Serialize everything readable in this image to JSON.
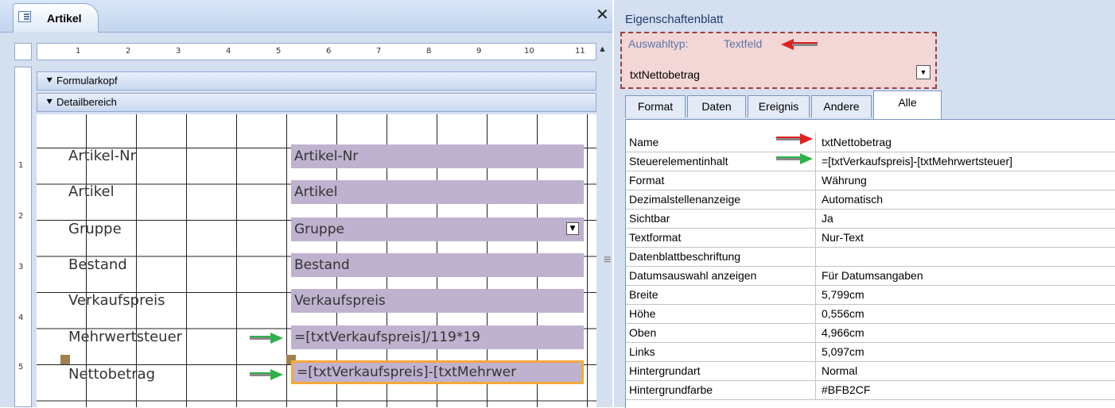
{
  "left_panel": {
    "tab_title": "Artikel",
    "close_label": "✕",
    "ruler_h": [
      "1",
      "2",
      "3",
      "4",
      "5",
      "6",
      "7",
      "8",
      "9",
      "10",
      "11"
    ],
    "ruler_v": [
      "1",
      "2",
      "3",
      "4",
      "5"
    ],
    "sections": {
      "header": "Formularkopf",
      "detail": "Detailbereich",
      "marker": "⯆"
    },
    "fields": [
      {
        "label": "Artikel-Nr",
        "control": "Artikel-Nr"
      },
      {
        "label": "Artikel",
        "control": "Artikel"
      },
      {
        "label": "Gruppe",
        "control": "Gruppe"
      },
      {
        "label": "Bestand",
        "control": "Bestand"
      },
      {
        "label": "Verkaufspreis",
        "control": "Verkaufspreis"
      },
      {
        "label": "Mehrwertsteuer",
        "control": "=[txtVerkaufspreis]/119*19"
      },
      {
        "label": "Nettobetrag",
        "control": "=[txtVerkaufspreis]-[txtMehrwer"
      }
    ],
    "combo_arrow": "▼"
  },
  "right_panel": {
    "title": "Eigenschaftenblatt",
    "selection_type_label": "Auswahltyp:",
    "selection_type_value": "Textfeld",
    "selected_object": "txtNettobetrag",
    "dropdown_arrow": "▼",
    "tabs": [
      "Format",
      "Daten",
      "Ereignis",
      "Andere",
      "Alle"
    ],
    "active_tab": "Alle",
    "properties": [
      {
        "name": "Name",
        "value": "txtNettobetrag"
      },
      {
        "name": "Steuerelementinhalt",
        "value": "=[txtVerkaufspreis]-[txtMehrwertsteuer]"
      },
      {
        "name": "Format",
        "value": "Währung"
      },
      {
        "name": "Dezimalstellenanzeige",
        "value": "Automatisch"
      },
      {
        "name": "Sichtbar",
        "value": "Ja"
      },
      {
        "name": "Textformat",
        "value": "Nur-Text"
      },
      {
        "name": "Datenblattbeschriftung",
        "value": ""
      },
      {
        "name": "Datumsauswahl anzeigen",
        "value": "Für Datumsangaben"
      },
      {
        "name": "Breite",
        "value": "5,799cm"
      },
      {
        "name": "Höhe",
        "value": "0,556cm"
      },
      {
        "name": "Oben",
        "value": "4,966cm"
      },
      {
        "name": "Links",
        "value": "5,097cm"
      },
      {
        "name": "Hintergrundart",
        "value": "Normal"
      },
      {
        "name": "Hintergrundfarbe",
        "value": "#BFB2CF"
      }
    ]
  },
  "colors": {
    "control_bg": "#BFB2CF",
    "selection_border": "#F5A83C",
    "green_arrow": "#2db24a",
    "red_arrow": "#e02020"
  }
}
